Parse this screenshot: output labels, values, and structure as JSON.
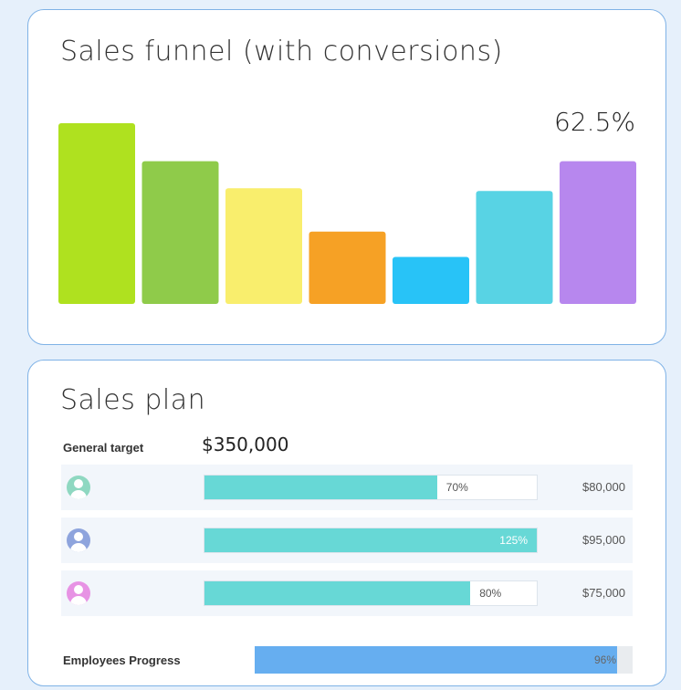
{
  "funnel": {
    "title": "Sales funnel (with conversions)",
    "conversion": "62.5%"
  },
  "chart_data": {
    "type": "bar",
    "values": [
      100,
      79,
      64,
      40,
      26,
      62.5,
      79
    ],
    "colors": [
      "#afe11f",
      "#8fcb4a",
      "#f9ee6d",
      "#f6a125",
      "#28c3f7",
      "#58d3e4",
      "#b787ee"
    ],
    "ylim": [
      0,
      100
    ],
    "grid": false,
    "title": "Sales funnel (with conversions)",
    "xlabel": "",
    "ylabel": ""
  },
  "plan": {
    "title": "Sales plan",
    "general_target_label": "General target",
    "general_target_value": "$350,000",
    "employees": [
      {
        "avatar_color": "#8fd8c1",
        "progress": 70,
        "pct_label": "70%",
        "amount": "$80,000"
      },
      {
        "avatar_color": "#8ea4dd",
        "progress": 100,
        "pct_label": "125%",
        "amount": "$95,000"
      },
      {
        "avatar_color": "#e793e4",
        "progress": 80,
        "pct_label": "80%",
        "amount": "$75,000"
      }
    ],
    "employees_progress_label": "Employees Progress",
    "employees_progress": 96,
    "employees_progress_pct": "96%"
  }
}
